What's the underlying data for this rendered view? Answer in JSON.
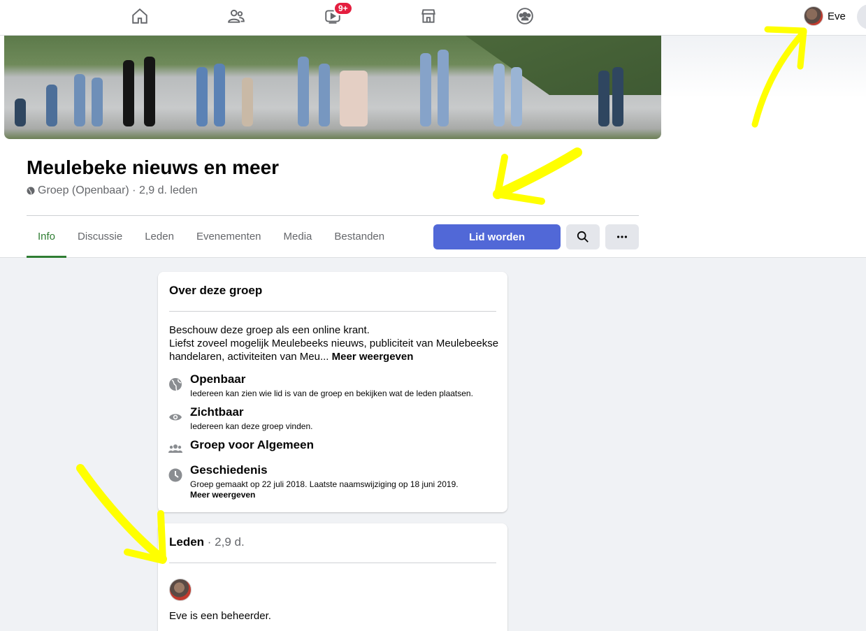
{
  "nav": {
    "notification_badge": "9+",
    "profile_name": "Eve",
    "icons": [
      "home-icon",
      "friends-icon",
      "watch-icon",
      "marketplace-icon",
      "groups-icon"
    ]
  },
  "group": {
    "name": "Meulebeke nieuws en meer",
    "meta": "Groep (Openbaar) · 2,9 d. leden"
  },
  "tabs": [
    "Info",
    "Discussie",
    "Leden",
    "Evenementen",
    "Media",
    "Bestanden"
  ],
  "actions": {
    "join_label": "Lid worden"
  },
  "about": {
    "title": "Over deze groep",
    "description": "Beschouw deze groep als een online krant.\nLiefst zoveel mogelijk Meulebeeks nieuws, publiciteit van Meulebeekse handelaren, activiteiten van Meu...",
    "more_label": "Meer weergeven",
    "items": [
      {
        "title": "Openbaar",
        "sub": "Iedereen kan zien wie lid is van de groep en bekijken wat de leden plaatsen.",
        "icon": "globe-icon"
      },
      {
        "title": "Zichtbaar",
        "sub": "Iedereen kan deze groep vinden.",
        "icon": "eye-icon"
      },
      {
        "title": "Groep voor Algemeen",
        "sub": "",
        "icon": "people-icon"
      },
      {
        "title": "Geschiedenis",
        "sub": "Groep gemaakt op 22 juli 2018. Laatste naamswijziging op 18 juni 2019.",
        "more": "Meer weergeven",
        "icon": "clock-icon"
      }
    ]
  },
  "members": {
    "title": "Leden",
    "count": " · 2,9 d.",
    "admin_text": "Eve is een beheerder."
  },
  "colors": {
    "accent_green": "#2e7d32",
    "join_button": "#5168d7",
    "annotation_yellow": "#ffff00"
  }
}
